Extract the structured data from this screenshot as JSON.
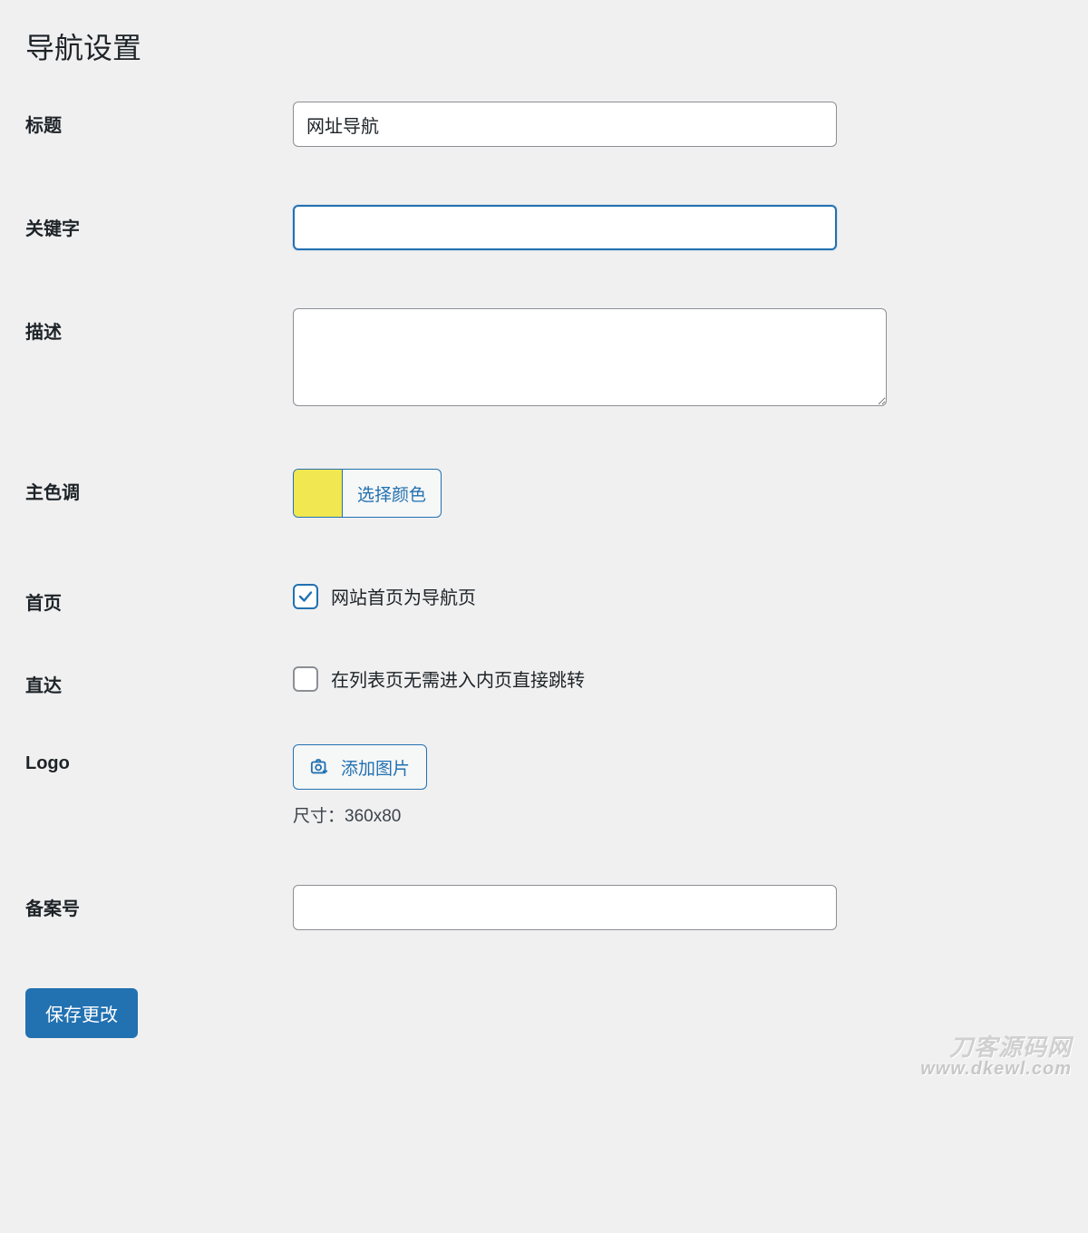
{
  "page": {
    "title": "导航设置"
  },
  "fields": {
    "title": {
      "label": "标题",
      "value": "网址导航"
    },
    "keywords": {
      "label": "关键字",
      "value": ""
    },
    "description": {
      "label": "描述",
      "value": ""
    },
    "color": {
      "label": "主色调",
      "button": "选择颜色",
      "value": "#f1e751"
    },
    "homepage": {
      "label": "首页",
      "option": "网站首页为导航页",
      "checked": true
    },
    "direct": {
      "label": "直达",
      "option": "在列表页无需进入内页直接跳转",
      "checked": false
    },
    "logo": {
      "label": "Logo",
      "button": "添加图片",
      "hint": "尺寸：360x80"
    },
    "icp": {
      "label": "备案号",
      "value": ""
    }
  },
  "actions": {
    "save": "保存更改"
  },
  "watermark": {
    "line1": "刀客源码网",
    "line2": "www.dkewl.com"
  }
}
